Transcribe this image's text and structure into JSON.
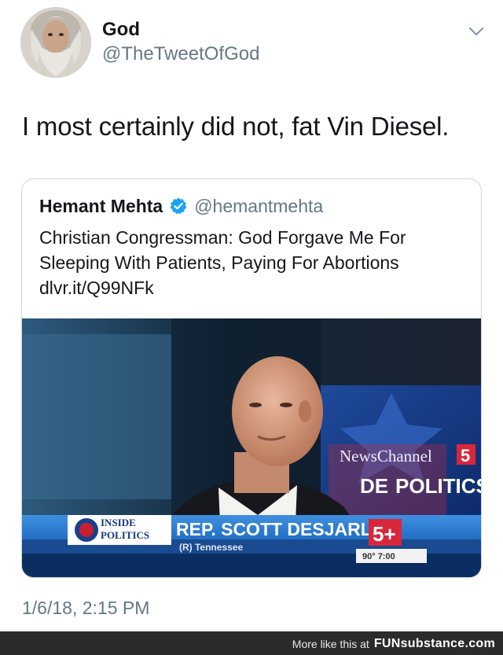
{
  "tweet": {
    "author_name": "God",
    "author_handle": "@TheTweetOfGod",
    "text": "I most certainly did not, fat Vin Diesel.",
    "timestamp": "1/6/18, 2:15 PM",
    "avatar_icon": "bearded-man-avatar",
    "menu_icon": "chevron-down-icon"
  },
  "quote": {
    "author_name": "Hemant Mehta",
    "author_handle": "@hemantmehta",
    "verified_icon": "verified-badge-icon",
    "text_line1": "Christian Congressman: God Forgave Me For",
    "text_line2": "Sleeping With Patients, Paying For Abortions",
    "link": "dlvr.it/Q99NFk",
    "media": {
      "network_label": "NewsChannel",
      "network_number": "5",
      "segment": "POLITICS",
      "segment_partial": "DE",
      "show_line1": "INSIDE",
      "show_line2": "POLITICS",
      "lower_third_name": "REP. SCOTT DESJARLAIS",
      "lower_third_sub": "(R) Tennessee",
      "corner_logo": "5+",
      "weather": "90°  7:00"
    }
  },
  "footer": {
    "text": "More like this at",
    "brand": "FUNsubstance.com"
  },
  "colors": {
    "name_text": "#14171a",
    "secondary_text": "#657786",
    "verified_blue": "#1da1f2",
    "card_border": "#cdd6dd",
    "footer_bg": "#2b2b2b"
  }
}
